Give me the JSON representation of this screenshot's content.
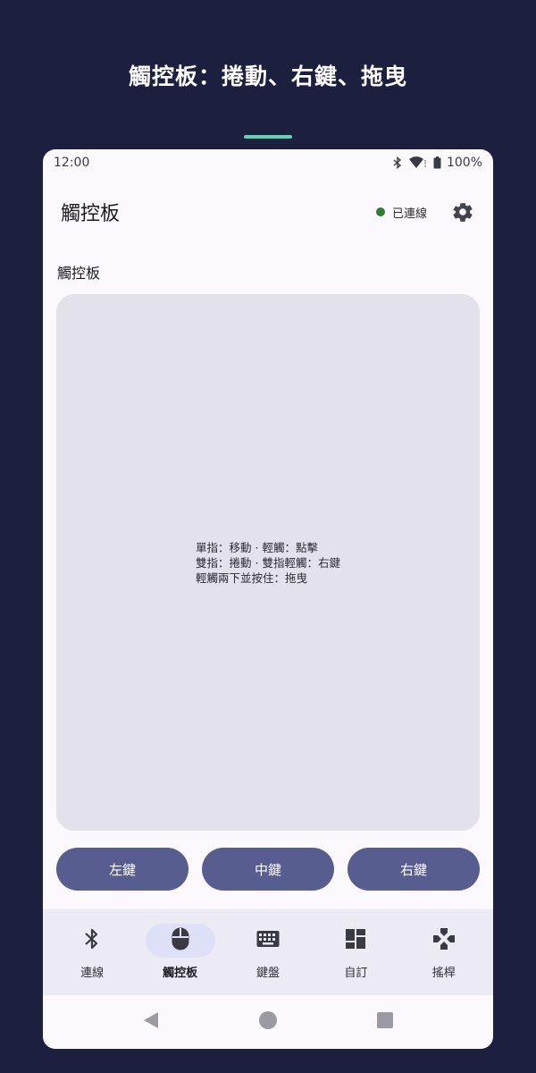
{
  "banner": {
    "title": "觸控板：捲動、右鍵、拖曳",
    "accent_color": "#5fd3b6"
  },
  "status_bar": {
    "time": "12:00",
    "battery": "100%",
    "icons": [
      "bluetooth-icon",
      "wifi-icon",
      "battery-icon"
    ]
  },
  "app_bar": {
    "title": "觸控板",
    "connection_status": "已連線",
    "connection_color": "#2e7d32",
    "settings_icon": "gear-icon"
  },
  "section": {
    "label": "觸控板"
  },
  "touchpad": {
    "hints": [
      "單指：移動 · 輕觸：點擊",
      "雙指：捲動 · 雙指輕觸：右鍵",
      "輕觸兩下並按住：拖曳"
    ]
  },
  "mouse_buttons": {
    "left": "左鍵",
    "middle": "中鍵",
    "right": "右鍵",
    "color": "#575d8f"
  },
  "bottom_nav": {
    "items": [
      {
        "label": "連線",
        "icon": "bluetooth-icon",
        "active": false
      },
      {
        "label": "觸控板",
        "icon": "mouse-icon",
        "active": true
      },
      {
        "label": "鍵盤",
        "icon": "keyboard-icon",
        "active": false
      },
      {
        "label": "自訂",
        "icon": "dashboard-icon",
        "active": false
      },
      {
        "label": "搖桿",
        "icon": "gamepad-icon",
        "active": false
      }
    ]
  },
  "system_nav": {
    "icons": [
      "back-icon",
      "home-icon",
      "recents-icon"
    ]
  }
}
